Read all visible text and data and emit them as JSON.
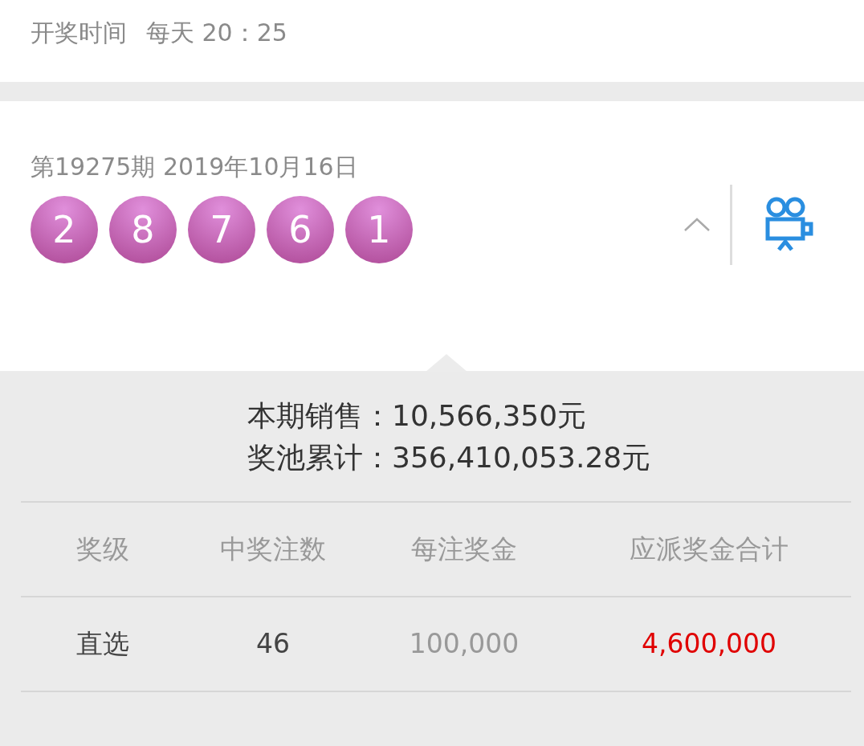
{
  "schedule": {
    "label": "开奖时间",
    "value": "每天 20：25"
  },
  "draw": {
    "issue": "第19275期 2019年10月16日",
    "balls": [
      "2",
      "8",
      "7",
      "6",
      "1"
    ],
    "expanded": true
  },
  "summary": [
    {
      "label": "本期销售：",
      "value": "10,566,350元"
    },
    {
      "label": "奖池累计：",
      "value": "356,410,053.28元"
    }
  ],
  "table": {
    "columns": [
      "奖级",
      "中奖注数",
      "每注奖金",
      "应派奖金合计"
    ],
    "rows": [
      [
        "直选",
        "46",
        "100,000",
        "4,600,000"
      ]
    ]
  }
}
